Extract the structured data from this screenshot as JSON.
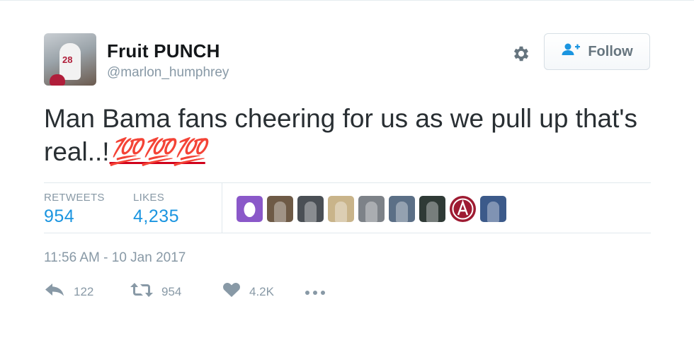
{
  "tweet": {
    "author_name": "Fruit PUNCH",
    "author_handle": "@marlon_humphrey",
    "follow_label": "Follow",
    "text_main": "Man Bama fans cheering for us as we pull up that's real..!",
    "text_emoji": "💯💯💯",
    "timestamp": "11:56 AM - 10 Jan 2017"
  },
  "stats": {
    "retweets_label": "RETWEETS",
    "retweets_value": "954",
    "likes_label": "LIKES",
    "likes_value": "4,235"
  },
  "likers": [
    {
      "name": "egg-avatar",
      "color": "#8a58c9"
    },
    {
      "name": "liker-avatar-2",
      "color": "#6e5a46"
    },
    {
      "name": "liker-avatar-3",
      "color": "#4a4f55"
    },
    {
      "name": "liker-avatar-4",
      "color": "#c9b48a"
    },
    {
      "name": "liker-avatar-5",
      "color": "#7d8288"
    },
    {
      "name": "liker-avatar-6",
      "color": "#5b6f86"
    },
    {
      "name": "liker-avatar-7",
      "color": "#2f3a36"
    },
    {
      "name": "alabama-logo-avatar",
      "color": "#9e1b32"
    },
    {
      "name": "liker-avatar-9",
      "color": "#3c5a8a"
    }
  ],
  "actions": {
    "reply_count": "122",
    "retweet_count": "954",
    "like_count": "4.2K"
  },
  "colors": {
    "accent_blue": "#1b95e0",
    "muted_gray": "#8899a6",
    "emoji_red": "#d0021b"
  }
}
